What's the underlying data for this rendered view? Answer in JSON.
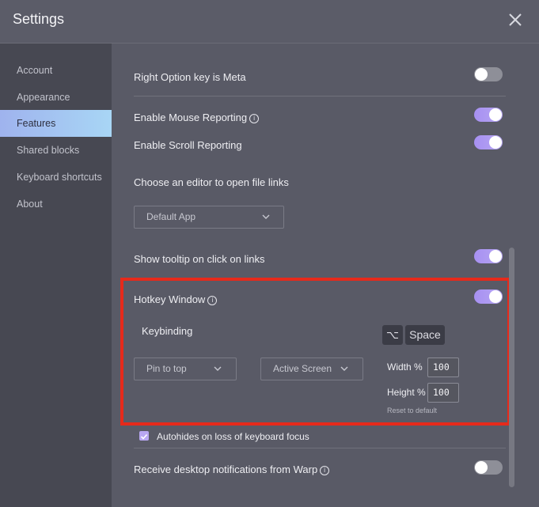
{
  "window": {
    "title": "Settings"
  },
  "sidebar": {
    "items": [
      {
        "label": "Account",
        "active": false
      },
      {
        "label": "Appearance",
        "active": false
      },
      {
        "label": "Features",
        "active": true
      },
      {
        "label": "Shared blocks",
        "active": false
      },
      {
        "label": "Keyboard shortcuts",
        "active": false
      },
      {
        "label": "About",
        "active": false
      }
    ]
  },
  "features": {
    "right_option_meta": {
      "label": "Right Option key is Meta",
      "enabled": false
    },
    "mouse_reporting": {
      "label": "Enable Mouse Reporting",
      "enabled": true,
      "icon": "info-icon"
    },
    "scroll_reporting": {
      "label": "Enable Scroll Reporting",
      "enabled": true
    },
    "editor": {
      "label": "Choose an editor to open file links",
      "value": "Default App"
    },
    "tooltip_links": {
      "label": "Show tooltip on click on links",
      "enabled": true
    },
    "hotkey_window": {
      "label": "Hotkey Window",
      "enabled": true,
      "icon": "info-icon",
      "keybinding_label": "Keybinding",
      "key_modifier": "⌥",
      "key_main": "Space",
      "pin_value": "Pin to top",
      "screen_value": "Active Screen",
      "width_label": "Width %",
      "width_value": "100",
      "height_label": "Height %",
      "height_value": "100",
      "reset_label": "Reset to default"
    },
    "autohide": {
      "label": "Autohides on loss of keyboard focus",
      "checked": true
    },
    "desktop_notifications": {
      "label": "Receive desktop notifications from Warp",
      "enabled": false,
      "icon": "info-icon"
    }
  },
  "colors": {
    "accent_toggle": "#a790f2",
    "active_sidebar": "#a8d6f5",
    "highlight_box": "#e62a1b"
  }
}
